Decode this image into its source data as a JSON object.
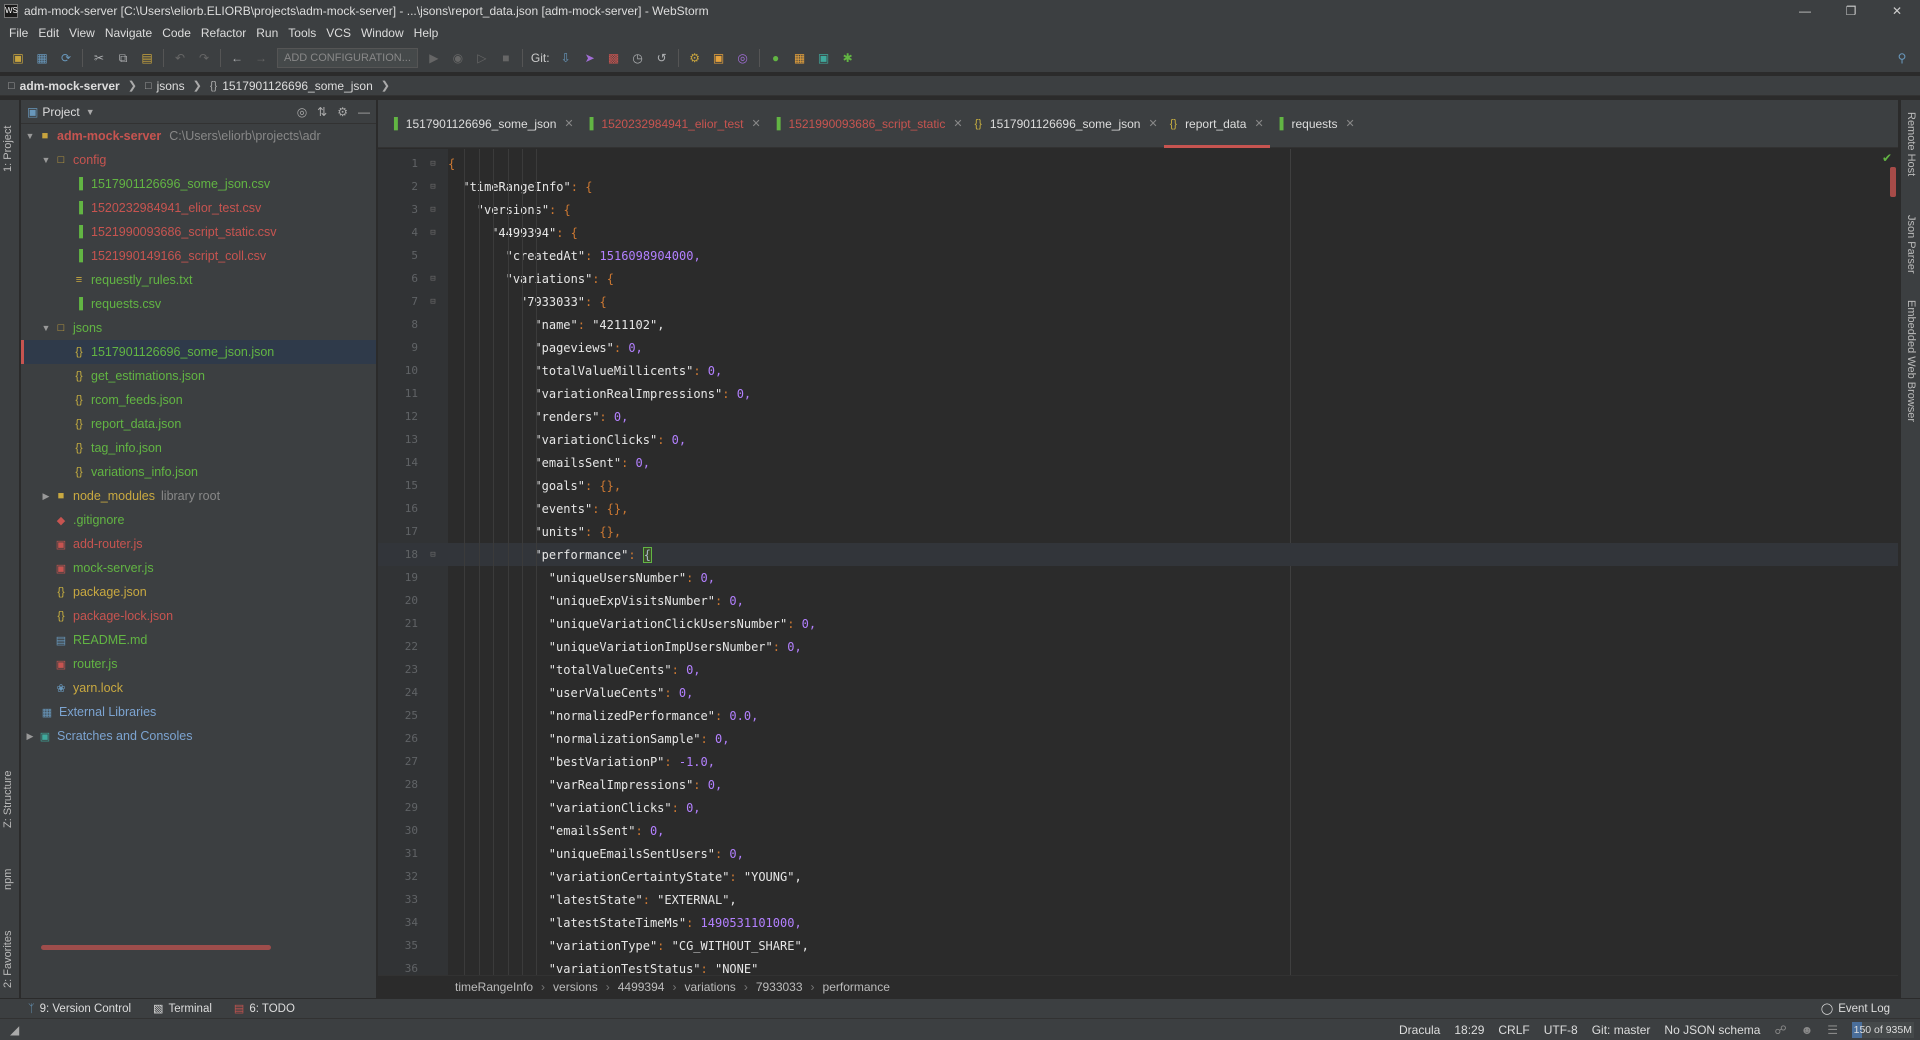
{
  "window": {
    "title": "adm-mock-server [C:\\Users\\eliorb.ELIORB\\projects\\adm-mock-server] - ...\\jsons\\report_data.json [adm-mock-server] - WebStorm",
    "app_icon": "WS"
  },
  "menu": [
    "File",
    "Edit",
    "View",
    "Navigate",
    "Code",
    "Refactor",
    "Run",
    "Tools",
    "VCS",
    "Window",
    "Help"
  ],
  "toolbar": {
    "run_config": "ADD CONFIGURATION...",
    "git_label": "Git:"
  },
  "navbar": {
    "crumbs": [
      "adm-mock-server",
      "jsons",
      "1517901126696_some_json"
    ]
  },
  "left_strip": {
    "project": "1: Project",
    "structure": "Z: Structure",
    "npm": "npm",
    "favorites": "2: Favorites"
  },
  "right_strip": {
    "remote_host": "Remote Host",
    "json_parser": "Json Parser",
    "embedded_browser": "Embedded Web Browser"
  },
  "project_panel": {
    "title": "Project",
    "root_name": "adm-mock-server",
    "root_path": "C:\\Users\\eliorb\\projects\\adr",
    "config_folder": "config",
    "config_files": [
      {
        "name": "1517901126696_some_json.csv",
        "color": "#62b543"
      },
      {
        "name": "1520232984941_elior_test.csv",
        "color": "#c75450"
      },
      {
        "name": "1521990093686_script_static.csv",
        "color": "#c75450"
      },
      {
        "name": "1521990149166_script_coll.csv",
        "color": "#c75450"
      },
      {
        "name": "requestly_rules.txt",
        "color": "#62b543"
      },
      {
        "name": "requests.csv",
        "color": "#62b543"
      }
    ],
    "jsons_folder": "jsons",
    "json_files": [
      {
        "name": "1517901126696_some_json.json",
        "color": "#62b543"
      },
      {
        "name": "get_estimations.json",
        "color": "#62b543"
      },
      {
        "name": "rcom_feeds.json",
        "color": "#62b543"
      },
      {
        "name": "report_data.json",
        "color": "#62b543"
      },
      {
        "name": "tag_info.json",
        "color": "#62b543"
      },
      {
        "name": "variations_info.json",
        "color": "#62b543"
      }
    ],
    "node_modules": "node_modules",
    "library_root": "library root",
    "root_files": [
      {
        "name": ".gitignore",
        "color": "#62b543"
      },
      {
        "name": "add-router.js",
        "color": "#c75450"
      },
      {
        "name": "mock-server.js",
        "color": "#62b543"
      },
      {
        "name": "package.json",
        "color": "#c9a941"
      },
      {
        "name": "package-lock.json",
        "color": "#c75450"
      },
      {
        "name": "README.md",
        "color": "#62b543"
      },
      {
        "name": "router.js",
        "color": "#62b543"
      },
      {
        "name": "yarn.lock",
        "color": "#c9a941"
      }
    ],
    "external_libraries": "External Libraries",
    "scratches": "Scratches and Consoles"
  },
  "tabs": [
    {
      "name": "1517901126696_some_json",
      "color": "#dddddd",
      "icon": "csv-icon"
    },
    {
      "name": "1520232984941_elior_test",
      "color": "#c75450",
      "icon": "csv-icon"
    },
    {
      "name": "1521990093686_script_static",
      "color": "#c75450",
      "icon": "csv-icon"
    },
    {
      "name": "1517901126696_some_json",
      "color": "#dddddd",
      "icon": "json-icon"
    },
    {
      "name": "report_data",
      "color": "#dddddd",
      "icon": "json-icon",
      "active": true
    },
    {
      "name": "requests",
      "color": "#dddddd",
      "icon": "csv-icon"
    }
  ],
  "code_lines": [
    {
      "n": "1",
      "indent": 0,
      "key": "",
      "val": "{",
      "vtype": "p"
    },
    {
      "n": "2",
      "indent": 1,
      "key": "\"timeRangeInfo\"",
      "val": "{",
      "vtype": "p"
    },
    {
      "n": "3",
      "indent": 2,
      "key": "\"versions\"",
      "val": "{",
      "vtype": "p"
    },
    {
      "n": "4",
      "indent": 3,
      "key": "\"4499394\"",
      "val": "{",
      "vtype": "p"
    },
    {
      "n": "5",
      "indent": 4,
      "key": "\"createdAt\"",
      "val": "1516098904000,",
      "vtype": "n"
    },
    {
      "n": "6",
      "indent": 4,
      "key": "\"variations\"",
      "val": "{",
      "vtype": "p"
    },
    {
      "n": "7",
      "indent": 5,
      "key": "\"7933033\"",
      "val": "{",
      "vtype": "p"
    },
    {
      "n": "8",
      "indent": 6,
      "key": "\"name\"",
      "val": "\"4211102\",",
      "vtype": "s"
    },
    {
      "n": "9",
      "indent": 6,
      "key": "\"pageviews\"",
      "val": "0,",
      "vtype": "n"
    },
    {
      "n": "10",
      "indent": 6,
      "key": "\"totalValueMillicents\"",
      "val": "0,",
      "vtype": "n"
    },
    {
      "n": "11",
      "indent": 6,
      "key": "\"variationRealImpressions\"",
      "val": "0,",
      "vtype": "n"
    },
    {
      "n": "12",
      "indent": 6,
      "key": "\"renders\"",
      "val": "0,",
      "vtype": "n"
    },
    {
      "n": "13",
      "indent": 6,
      "key": "\"variationClicks\"",
      "val": "0,",
      "vtype": "n"
    },
    {
      "n": "14",
      "indent": 6,
      "key": "\"emailsSent\"",
      "val": "0,",
      "vtype": "n"
    },
    {
      "n": "15",
      "indent": 6,
      "key": "\"goals\"",
      "val": "{},",
      "vtype": "p"
    },
    {
      "n": "16",
      "indent": 6,
      "key": "\"events\"",
      "val": "{},",
      "vtype": "p"
    },
    {
      "n": "17",
      "indent": 6,
      "key": "\"units\"",
      "val": "{},",
      "vtype": "p"
    },
    {
      "n": "18",
      "indent": 6,
      "key": "\"performance\"",
      "val": "{",
      "vtype": "cursor",
      "current": true
    },
    {
      "n": "19",
      "indent": 7,
      "key": "\"uniqueUsersNumber\"",
      "val": "0,",
      "vtype": "n"
    },
    {
      "n": "20",
      "indent": 7,
      "key": "\"uniqueExpVisitsNumber\"",
      "val": "0,",
      "vtype": "n"
    },
    {
      "n": "21",
      "indent": 7,
      "key": "\"uniqueVariationClickUsersNumber\"",
      "val": "0,",
      "vtype": "n"
    },
    {
      "n": "22",
      "indent": 7,
      "key": "\"uniqueVariationImpUsersNumber\"",
      "val": "0,",
      "vtype": "n"
    },
    {
      "n": "23",
      "indent": 7,
      "key": "\"totalValueCents\"",
      "val": "0,",
      "vtype": "n"
    },
    {
      "n": "24",
      "indent": 7,
      "key": "\"userValueCents\"",
      "val": "0,",
      "vtype": "n"
    },
    {
      "n": "25",
      "indent": 7,
      "key": "\"normalizedPerformance\"",
      "val": "0.0,",
      "vtype": "n"
    },
    {
      "n": "26",
      "indent": 7,
      "key": "\"normalizationSample\"",
      "val": "0,",
      "vtype": "n"
    },
    {
      "n": "27",
      "indent": 7,
      "key": "\"bestVariationP\"",
      "val": "-1.0,",
      "vtype": "n"
    },
    {
      "n": "28",
      "indent": 7,
      "key": "\"varRealImpressions\"",
      "val": "0,",
      "vtype": "n"
    },
    {
      "n": "29",
      "indent": 7,
      "key": "\"variationClicks\"",
      "val": "0,",
      "vtype": "n"
    },
    {
      "n": "30",
      "indent": 7,
      "key": "\"emailsSent\"",
      "val": "0,",
      "vtype": "n"
    },
    {
      "n": "31",
      "indent": 7,
      "key": "\"uniqueEmailsSentUsers\"",
      "val": "0,",
      "vtype": "n"
    },
    {
      "n": "32",
      "indent": 7,
      "key": "\"variationCertaintyState\"",
      "val": "\"YOUNG\",",
      "vtype": "s"
    },
    {
      "n": "33",
      "indent": 7,
      "key": "\"latestState\"",
      "val": "\"EXTERNAL\",",
      "vtype": "s"
    },
    {
      "n": "34",
      "indent": 7,
      "key": "\"latestStateTimeMs\"",
      "val": "1490531101000,",
      "vtype": "n"
    },
    {
      "n": "35",
      "indent": 7,
      "key": "\"variationType\"",
      "val": "\"CG_WITHOUT_SHARE\",",
      "vtype": "s"
    },
    {
      "n": "36",
      "indent": 7,
      "key": "\"variationTestStatus\"",
      "val": "\"NONE\"",
      "vtype": "s"
    }
  ],
  "editor_crumbs": [
    "timeRangeInfo",
    "versions",
    "4499394",
    "variations",
    "7933033",
    "performance"
  ],
  "bottom_bar": {
    "version_control": "9: Version Control",
    "terminal": "Terminal",
    "todo": "6: TODO",
    "event_log": "Event Log"
  },
  "status": {
    "theme": "Dracula",
    "position": "18:29",
    "line_sep": "CRLF",
    "encoding": "UTF-8",
    "git": "Git: master",
    "schema": "No JSON schema",
    "memory": "150 of 935M",
    "memory_fraction": 0.16
  }
}
